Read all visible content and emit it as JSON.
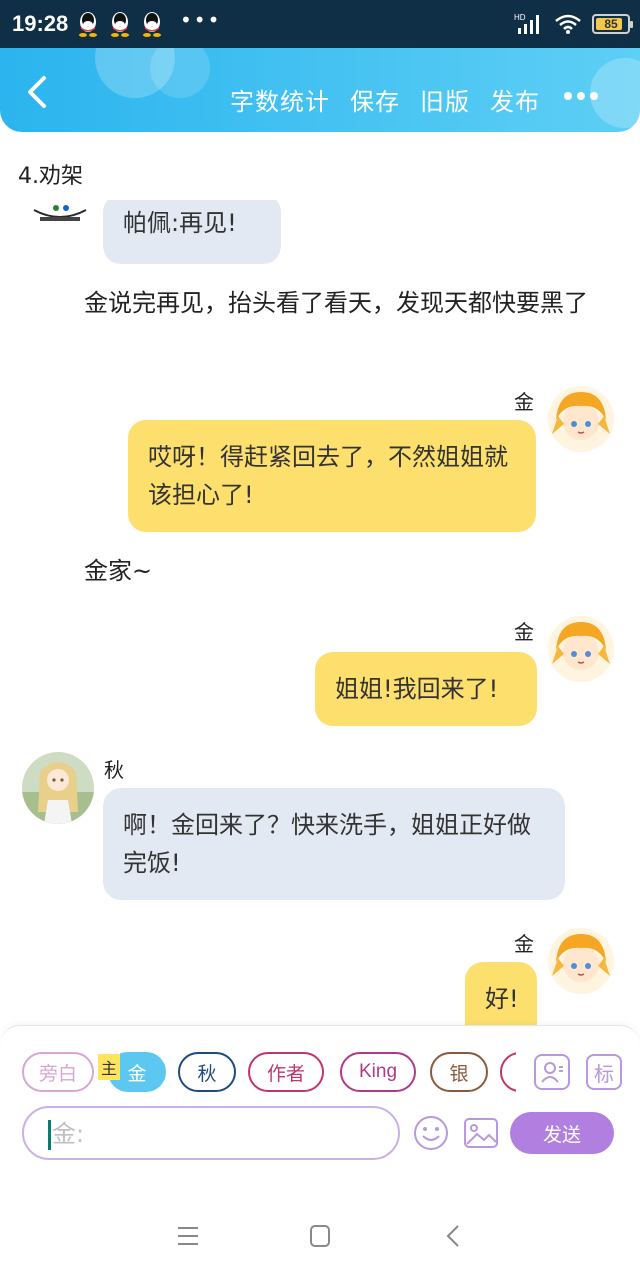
{
  "status_bar": {
    "time": "19:28",
    "dots": "•••",
    "battery_level": "85",
    "net": "HD",
    "accent": "#0f2f47"
  },
  "header": {
    "actions": [
      "字数统计",
      "保存",
      "旧版",
      "发布"
    ],
    "back_icon": "chevron-left-icon",
    "more_icon": "more-dots-icon",
    "color": "#2bb4ee"
  },
  "chapter_title": "4.劝架",
  "messages": {
    "m1_text": "帕佩:再见!",
    "narration1": "金说完再见，抬头看了看天，发现天都快要黑了",
    "m2_name": "金",
    "m2_text": "哎呀！得赶紧回去了，不然姐姐就该担心了!",
    "narration2": "金家~",
    "m3_name": "金",
    "m3_text": "姐姐!我回来了!",
    "m4_name": "秋",
    "m4_text": "啊！金回来了？快来洗手，姐姐正好做完饭!",
    "m5_name": "金",
    "m5_text": "好!"
  },
  "composer": {
    "chips": [
      "旁白",
      "金",
      "秋",
      "作者",
      "King",
      "银"
    ],
    "main_tag": "主",
    "input_value": "",
    "input_placeholder": "金:",
    "send_label": "发送",
    "tag_button_label": "标",
    "accent": "#b07fe0"
  }
}
